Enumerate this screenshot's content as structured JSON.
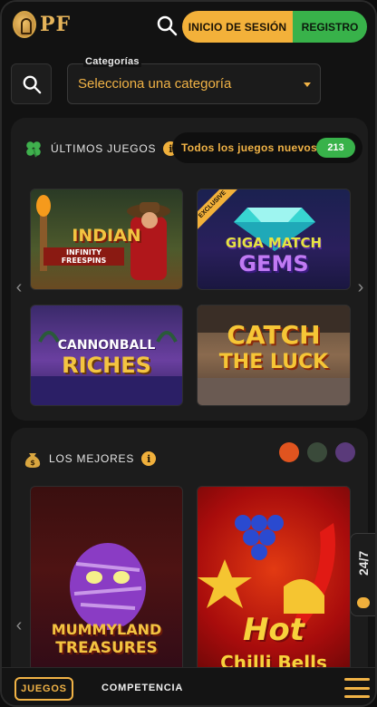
{
  "header": {
    "logo_text": "PF",
    "login_label": "INICIO DE SESIÓN",
    "register_label": "REGISTRO"
  },
  "categories": {
    "label": "Categorías",
    "placeholder": "Selecciona una categoría"
  },
  "latest": {
    "title": "ÚLTIMOS JUEGOS",
    "all_new_label": "Todos los juegos nuevos",
    "count": "213",
    "games": [
      {
        "name": "INDIAN",
        "sub": "INFINITY FREESPINS"
      },
      {
        "name": "GIGA MATCH",
        "sub": "GEMS",
        "badge": "EXCLUSIVE"
      },
      {
        "name": "CANNONBALL",
        "sub": "RICHES"
      },
      {
        "name": "CATCH",
        "sub": "THE LUCK"
      }
    ]
  },
  "best": {
    "title": "LOS MEJORES",
    "games": [
      {
        "name": "MUMMYLAND",
        "sub": "TREASURES"
      },
      {
        "name": "Hot",
        "sub": "Chilli Bells"
      }
    ]
  },
  "support_label": "24/7",
  "bottom": {
    "games_label": "JUEGOS",
    "competition_label": "COMPETENCIA"
  },
  "colors": {
    "accent": "#f1b346",
    "green": "#38b24a",
    "background": "#121212"
  }
}
